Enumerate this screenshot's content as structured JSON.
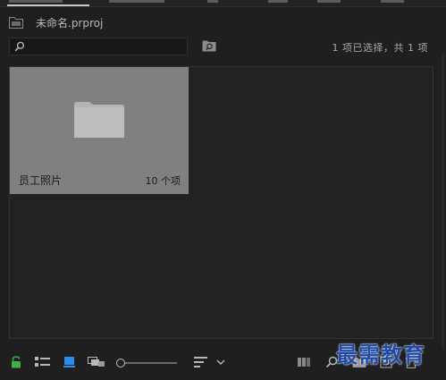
{
  "project": {
    "name": "未命名.prproj"
  },
  "search": {
    "value": "",
    "placeholder": ""
  },
  "status": {
    "selection": "1 项已选择，共 1 项"
  },
  "bin": {
    "name": "员工照片",
    "item_count": "10 个项"
  },
  "toolbar": {
    "zoom_level": 0,
    "items": [
      "lock-icon",
      "list-view-icon",
      "icon-view-icon",
      "freeform-view-icon",
      "zoom-slider",
      "sort-icon",
      "sort-dropdown",
      "automate-sequence-icon",
      "find-icon",
      "new-bin-icon",
      "new-item-icon",
      "clear-icon"
    ]
  },
  "watermark": {
    "text": "最需教育"
  },
  "colors": {
    "background": "#1f1f1f",
    "panel": "#222222",
    "tile": "#808080",
    "lock_green": "#3fae49",
    "accent_blue": "#2d8ceb",
    "watermark": "#1f4aa8"
  }
}
